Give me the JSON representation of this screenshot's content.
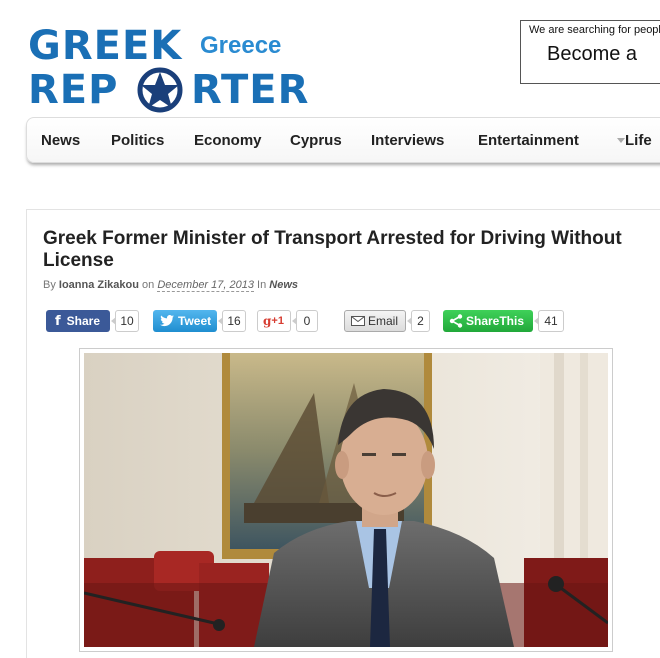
{
  "logo": {
    "line1": "GREEK",
    "line2": "REP RTER",
    "greece": "Greece"
  },
  "ad": {
    "small": "We are searching for people i",
    "big": "Become a"
  },
  "nav": {
    "items": [
      "News",
      "Politics",
      "Economy",
      "Cyprus",
      "Interviews",
      "Entertainment",
      "Life"
    ]
  },
  "article": {
    "title": "Greek Former Minister of Transport Arrested for Driving Without License",
    "by_prefix": "By",
    "author": "Ioanna Zikakou",
    "on": "on",
    "date": "December 17, 2013",
    "in": "In",
    "category": "News"
  },
  "share": {
    "facebook": {
      "label": "Share",
      "count": "10"
    },
    "twitter": {
      "label": "Tweet",
      "count": "16"
    },
    "gplus": {
      "label": "+1",
      "count": "0"
    },
    "email": {
      "label": "Email",
      "count": "2"
    },
    "sharethis": {
      "label": "ShareThis",
      "count": "41"
    }
  },
  "colors": {
    "logo_blue": "#1a6fb5",
    "facebook": "#3b5998",
    "twitter": "#2aa3e6",
    "sharethis": "#2ec24a"
  }
}
